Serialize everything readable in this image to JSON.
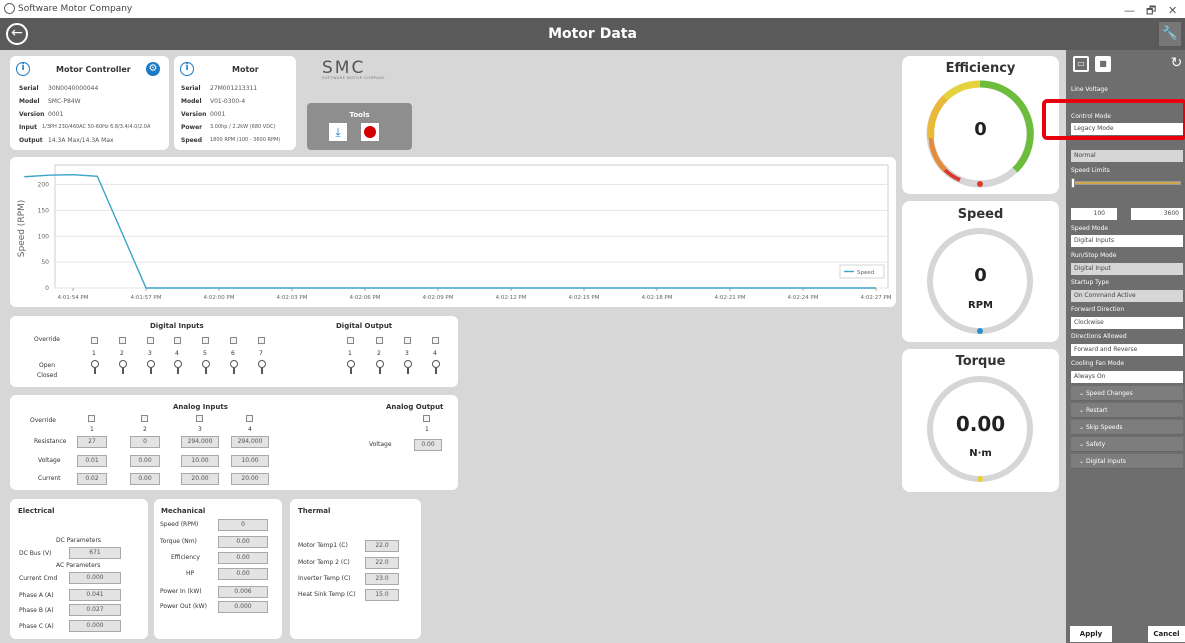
{
  "window": {
    "title": "Software Motor Company",
    "minimize": "—",
    "maximize": "🗗",
    "close": "✕"
  },
  "header": {
    "title": "Motor Data"
  },
  "motor_controller": {
    "title": "Motor Controller",
    "serial_label": "Serial",
    "serial": "30N0040000044",
    "model_label": "Model",
    "model": "SMC-P84W",
    "version_label": "Version",
    "version": "0001",
    "input_label": "Input",
    "input": "1/3PH 230/460AC 50-60Hz 6.8/3.4/4.0/2.0A",
    "output_label": "Output",
    "output": "14.3A Max/14.3A Max"
  },
  "motor": {
    "title": "Motor",
    "serial_label": "Serial",
    "serial": "27M001213311",
    "model_label": "Model",
    "model": "V01-0300-4",
    "version_label": "Version",
    "version": "0001",
    "power_label": "Power",
    "power": "3.00hp / 2.2kW (680 VDC)",
    "speed_label": "Speed",
    "speed": "1800 RPM (100 - 3600 RPM)"
  },
  "brand": {
    "name": "SMC",
    "tagline": "SOFTWARE MOTOR COMPANY"
  },
  "tools": {
    "title": "Tools"
  },
  "chart_data": {
    "type": "line",
    "ylabel": "Speed (RPM)",
    "ylim": [
      0,
      230
    ],
    "yticks": [
      "200",
      "150",
      "100",
      "50",
      "0"
    ],
    "x_ticks": [
      "4:01:54 PM",
      "4:01:57 PM",
      "4:02:00 PM",
      "4:02:03 PM",
      "4:02:06 PM",
      "4:02:09 PM",
      "4:02:12 PM",
      "4:02:15 PM",
      "4:02:18 PM",
      "4:02:21 PM",
      "4:02:24 PM",
      "4:02:27 PM"
    ],
    "series": [
      {
        "name": "Speed",
        "color": "#3aa3c8",
        "points": [
          [
            "4:01:52 PM",
            215
          ],
          [
            "4:01:53 PM",
            218
          ],
          [
            "4:01:54 PM",
            219
          ],
          [
            "4:01:55 PM",
            216
          ],
          [
            "4:01:57 PM",
            0
          ],
          [
            "4:02:27 PM",
            0
          ]
        ]
      }
    ],
    "grid": true,
    "legend": "bottom-right"
  },
  "digital_inputs": {
    "title": "Digital Inputs",
    "override_label": "Override",
    "open_label": "Open",
    "closed_label": "Closed",
    "channels": [
      "1",
      "2",
      "3",
      "4",
      "5",
      "6",
      "7"
    ]
  },
  "digital_output": {
    "title": "Digital Output",
    "channels": [
      "1",
      "2",
      "3",
      "4"
    ]
  },
  "analog_inputs": {
    "title": "Analog Inputs",
    "override_label": "Override",
    "resistance_label": "Resistance",
    "voltage_label": "Voltage",
    "current_label": "Current",
    "channels": [
      "1",
      "2",
      "3",
      "4"
    ],
    "resistance": [
      "27",
      "0",
      "294,000",
      "294,000"
    ],
    "voltage": [
      "0.01",
      "0.00",
      "10.00",
      "10.00"
    ],
    "current": [
      "0.02",
      "0.00",
      "20.00",
      "20.00"
    ]
  },
  "analog_output": {
    "title": "Analog Output",
    "channel": "1",
    "voltage_label": "Voltage",
    "voltage": "0.00"
  },
  "electrical": {
    "title": "Electrical",
    "dc_params": "DC Parameters",
    "dc_bus_label": "DC Bus (V)",
    "dc_bus": "671",
    "ac_params": "AC Parameters",
    "current_cmd_label": "Current Cmd",
    "current_cmd": "0.000",
    "phase_a_label": "Phase A (A)",
    "phase_a": "0.041",
    "phase_b_label": "Phase B (A)",
    "phase_b": "0.027",
    "phase_c_label": "Phase C (A)",
    "phase_c": "0.000"
  },
  "mechanical": {
    "title": "Mechanical",
    "speed_label": "Speed (RPM)",
    "speed": "0",
    "torque_label": "Torque (Nm)",
    "torque": "0.00",
    "efficiency_label": "Efficiency",
    "efficiency": "0.00",
    "hp_label": "HP",
    "hp": "0.00",
    "power_in_label": "Power In (kW)",
    "power_in": "0.006",
    "power_out_label": "Power Out (kW)",
    "power_out": "0.000"
  },
  "thermal": {
    "title": "Thermal",
    "motor_temp1_label": "Motor Temp1 (C)",
    "motor_temp1": "22.0",
    "motor_temp2_label": "Motor Temp 2 (C)",
    "motor_temp2": "22.0",
    "inverter_temp_label": "Inverter Temp (C)",
    "inverter_temp": "23.0",
    "heatsink_temp_label": "Heat Sink Temp (C)",
    "heatsink_temp": "15.0"
  },
  "gauges": {
    "efficiency": {
      "title": "Efficiency",
      "value": "0"
    },
    "speed": {
      "title": "Speed",
      "value": "0",
      "unit": "RPM"
    },
    "torque": {
      "title": "Torque",
      "value": "0.00",
      "unit": "N·m"
    }
  },
  "right_panel": {
    "line_voltage_label": "Line Voltage",
    "control_mode_label": "Control Mode",
    "control_mode": "Legacy Mode",
    "mode_value": "Normal",
    "speed_limits_label": "Speed Limits",
    "speed_min": "100",
    "speed_max": "3600",
    "speed_mode_label": "Speed Mode",
    "speed_mode": "Digital Inputs",
    "run_stop_label": "Run/Stop Mode",
    "run_stop": "Digital Input",
    "startup_type_label": "Startup Type",
    "startup_type": "On Command Active",
    "forward_dir_label": "Forward Direction",
    "forward_dir": "Clockwise",
    "directions_allowed_label": "Directions Allowed",
    "directions_allowed": "Forward and Reverse",
    "cooling_fan_label": "Cooling Fan Mode",
    "cooling_fan": "Always On",
    "sections": [
      "Speed Changes",
      "Restart",
      "Skip Speeds",
      "Safety",
      "Digital Inputs"
    ],
    "apply": "Apply",
    "cancel": "Cancel"
  },
  "colors": {
    "header": "#5a5a5a",
    "panel": "#6e6e6e",
    "accent_blue": "#1c7ac4",
    "highlight_red": "#e8000d",
    "record_red": "#d40000"
  }
}
